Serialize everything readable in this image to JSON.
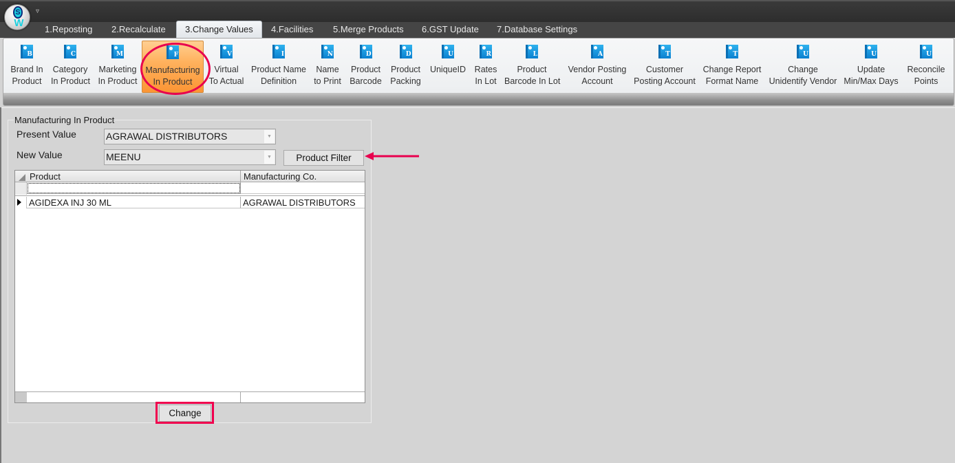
{
  "app": {
    "qat_icon": "quick-access-dropdown-icon",
    "logo": {
      "letter": "S",
      "mark": "W"
    }
  },
  "tabs": [
    {
      "label": "1.Reposting",
      "active": false
    },
    {
      "label": "2.Recalculate",
      "active": false
    },
    {
      "label": "3.Change Values",
      "active": true
    },
    {
      "label": "4.Facilities",
      "active": false
    },
    {
      "label": "5.Merge Products",
      "active": false
    },
    {
      "label": "6.GST Update",
      "active": false
    },
    {
      "label": "7.Database Settings",
      "active": false
    }
  ],
  "ribbon": {
    "buttons": [
      {
        "line1": "Brand In",
        "line2": "Product",
        "glyph": "B",
        "active": false
      },
      {
        "line1": "Category",
        "line2": "In Product",
        "glyph": "C",
        "active": false
      },
      {
        "line1": "Marketing",
        "line2": "In Product",
        "glyph": "M",
        "active": false
      },
      {
        "line1": "Manufacturing",
        "line2": "In Product",
        "glyph": "F",
        "active": true
      },
      {
        "line1": "Virtual",
        "line2": "To Actual",
        "glyph": "V",
        "active": false
      },
      {
        "line1": "Product Name",
        "line2": "Definition",
        "glyph": "I",
        "active": false
      },
      {
        "line1": "Name",
        "line2": "to Print",
        "glyph": "N",
        "active": false
      },
      {
        "line1": "Product",
        "line2": "Barcode",
        "glyph": "D",
        "active": false
      },
      {
        "line1": "Product",
        "line2": "Packing",
        "glyph": "D",
        "active": false
      },
      {
        "line1": "UniqueID",
        "line2": "",
        "glyph": "U",
        "active": false
      },
      {
        "line1": "Rates",
        "line2": "In Lot",
        "glyph": "R",
        "active": false
      },
      {
        "line1": "Product",
        "line2": "Barcode In Lot",
        "glyph": "L",
        "active": false
      },
      {
        "line1": "Vendor Posting",
        "line2": "Account",
        "glyph": "A",
        "active": false
      },
      {
        "line1": "Customer",
        "line2": "Posting Account",
        "glyph": "T",
        "active": false
      },
      {
        "line1": "Change Report",
        "line2": "Format Name",
        "glyph": "T",
        "active": false
      },
      {
        "line1": "Change",
        "line2": "Unidentify Vendor",
        "glyph": "U",
        "active": false
      },
      {
        "line1": "Update",
        "line2": "Min/Max Days",
        "glyph": "U",
        "active": false
      },
      {
        "line1": "Reconcile",
        "line2": "Points",
        "glyph": "U",
        "active": false
      }
    ]
  },
  "form": {
    "group_title": "Manufacturing In Product",
    "present_value_label": "Present Value",
    "present_value": "AGRAWAL DISTRIBUTORS",
    "new_value_label": "New Value",
    "new_value": "MEENU",
    "product_filter_label": "Product Filter",
    "change_label": "Change"
  },
  "grid": {
    "columns": [
      "Product",
      "Manufacturing Co."
    ],
    "filter_row": [
      "",
      ""
    ],
    "rows": [
      [
        "AGIDEXA INJ 30 ML",
        "AGRAWAL DISTRIBUTORS"
      ]
    ]
  },
  "annotations": {
    "color": "#e8004e"
  }
}
